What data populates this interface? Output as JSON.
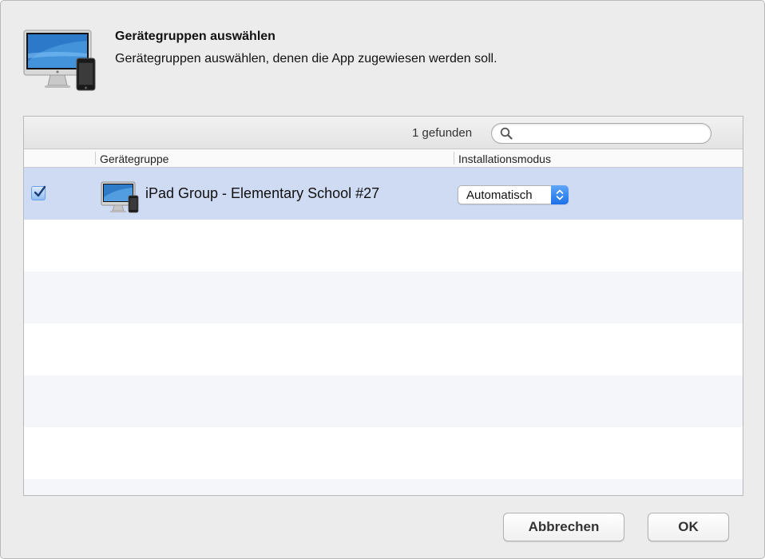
{
  "dialog": {
    "title": "Gerätegruppen auswählen",
    "subtitle": "Gerätegruppen auswählen, denen die App zugewiesen werden soll.",
    "header_icon": "imac-iphone-icon"
  },
  "search": {
    "found_text": "1 gefunden",
    "placeholder": "",
    "value": ""
  },
  "table": {
    "columns": [
      "Gerätegruppe",
      "Installationsmodus"
    ],
    "rows": [
      {
        "checked": true,
        "icon": "device-group-icon",
        "name": "iPad Group - Elementary School #27",
        "mode": "Automatisch"
      }
    ]
  },
  "buttons": {
    "cancel": "Abbrechen",
    "ok": "OK"
  },
  "colors": {
    "selected_row": "#cfdaf3",
    "accent": "#1c6fe8"
  }
}
